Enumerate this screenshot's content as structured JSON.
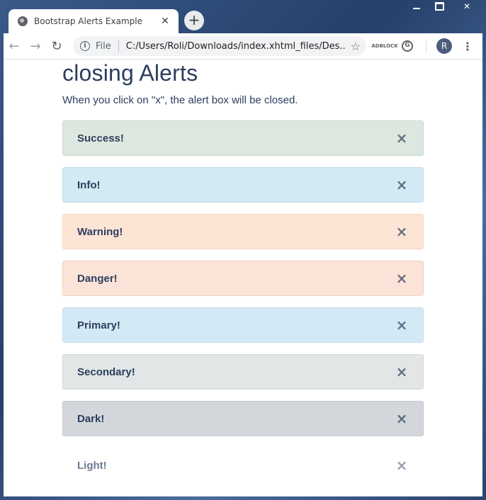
{
  "window": {
    "minimize_icon": "minimize-icon",
    "maximize_icon": "maximize-icon",
    "close_glyph": "✕"
  },
  "tab": {
    "title": "Bootstrap Alerts Example",
    "close_glyph": "✕",
    "new_tab_glyph": "+"
  },
  "toolbar": {
    "back_glyph": "←",
    "forward_glyph": "→",
    "reload_glyph": "↻",
    "info_glyph": "i",
    "file_label": "File",
    "url": "C:/Users/Roli/Downloads/index.xhtml_files/Des...",
    "star_glyph": "☆",
    "ext_label": "ADBLOCK",
    "grammarly_glyph": "G",
    "avatar_letter": "R",
    "menu_glyph": "⋮"
  },
  "page": {
    "heading": "closing Alerts",
    "lead": "When you click on \"x\", the alert box will be closed.",
    "alerts": [
      {
        "label": "Success!",
        "variant": "success",
        "close": "×",
        "color": "#dce8df"
      },
      {
        "label": "Info!",
        "variant": "info",
        "close": "×",
        "color": "#d3e9f3"
      },
      {
        "label": "Warning!",
        "variant": "warning",
        "close": "×",
        "color": "#fde5d6"
      },
      {
        "label": "Danger!",
        "variant": "danger",
        "close": "×",
        "color": "#fbe3d7"
      },
      {
        "label": "Primary!",
        "variant": "primary",
        "close": "×",
        "color": "#d4e9f6"
      },
      {
        "label": "Secondary!",
        "variant": "secondary",
        "close": "×",
        "color": "#e2e6e6"
      },
      {
        "label": "Dark!",
        "variant": "dark",
        "close": "×",
        "color": "#d3d7dc"
      },
      {
        "label": "Light!",
        "variant": "light",
        "close": "×",
        "color": "#ffffff"
      }
    ],
    "text_color": "#2c3e5e"
  }
}
